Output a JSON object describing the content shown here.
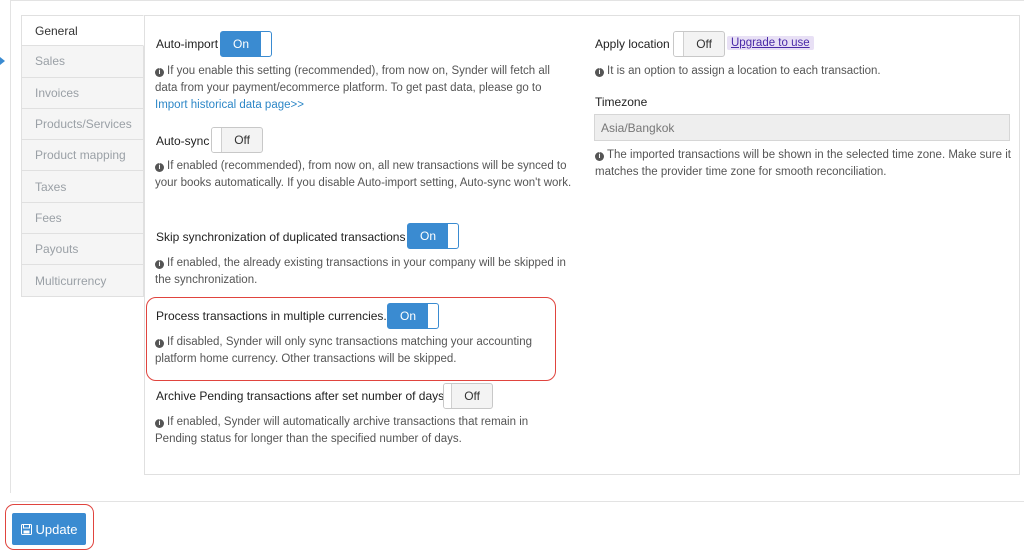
{
  "tabs": [
    "General",
    "Sales",
    "Invoices",
    "Products/Services",
    "Product mapping",
    "Taxes",
    "Fees",
    "Payouts",
    "Multicurrency"
  ],
  "active_tab": "General",
  "left": {
    "auto_import": {
      "label": "Auto-import",
      "state": "On",
      "desc": "If you enable this setting (recommended), from now on, Synder will fetch all data from your payment/ecommerce platform. To get past data, please go to",
      "link": "Import historical data page>>"
    },
    "auto_sync": {
      "label": "Auto-sync",
      "state": "Off",
      "desc": "If enabled (recommended), from now on, all new transactions will be synced to your books automatically. If you disable Auto-import setting, Auto-sync won't work."
    },
    "skip_duplicates": {
      "label": "Skip synchronization of duplicated transactions",
      "state": "On",
      "desc": "If enabled, the already existing transactions in your company will be skipped in the synchronization."
    },
    "multi_currency": {
      "label": "Process transactions in multiple currencies.",
      "state": "On",
      "desc": "If disabled, Synder will only sync transactions matching your accounting platform home currency. Other transactions will be skipped."
    },
    "archive_pending": {
      "label": "Archive Pending transactions after set number of days",
      "state": "Off",
      "desc": "If enabled, Synder will automatically archive transactions that remain in Pending status for longer than the specified number of days."
    }
  },
  "right": {
    "apply_location": {
      "label": "Apply location",
      "state": "Off",
      "upgrade": "Upgrade to use",
      "desc": "It is an option to assign a location to each transaction."
    },
    "timezone": {
      "label": "Timezone",
      "value": "Asia/Bangkok",
      "desc": "The imported transactions will be shown in the selected time zone. Make sure it matches the provider time zone for smooth reconciliation."
    }
  },
  "update_label": "Update",
  "colors": {
    "accent": "#3a8bd1",
    "highlight": "#e0443e",
    "upgrade_bg": "#e8e0f5"
  }
}
